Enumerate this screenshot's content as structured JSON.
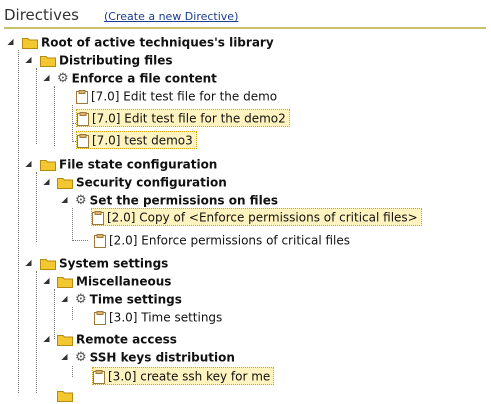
{
  "header": {
    "title": "Directives",
    "create_link": "(Create a new Directive)"
  },
  "tree": {
    "root": "Root of active techniques's library",
    "cat_distributing": "Distributing files",
    "tech_enforce_content": "Enforce a file content",
    "dir_edit_test": "[7.0] Edit test file for the demo",
    "dir_edit_test2": "[7.0] Edit test file for the demo2",
    "dir_test_demo3": "[7.0] test demo3",
    "cat_file_state": "File state configuration",
    "cat_security": "Security configuration",
    "tech_set_perms": "Set the permissions on files",
    "dir_copy_enforce": "[2.0] Copy of <Enforce permissions of critical files>",
    "dir_enforce_perms": "[2.0] Enforce permissions of critical files",
    "cat_system": "System settings",
    "cat_misc": "Miscellaneous",
    "tech_time": "Time settings",
    "dir_time": "[3.0] Time settings",
    "cat_remote": "Remote access",
    "tech_ssh": "SSH keys distribution",
    "dir_ssh_key": "[3.0] create ssh key for me"
  },
  "icons": {
    "folder": "folder-icon",
    "technique": "gear-icon",
    "directive": "document-icon",
    "toggle": "collapse-toggle-icon"
  },
  "colors": {
    "folder": "#f3c730",
    "selected_bg": "#fff3c0",
    "link": "#1a3d8f",
    "header_rule": "#c8c16a"
  }
}
